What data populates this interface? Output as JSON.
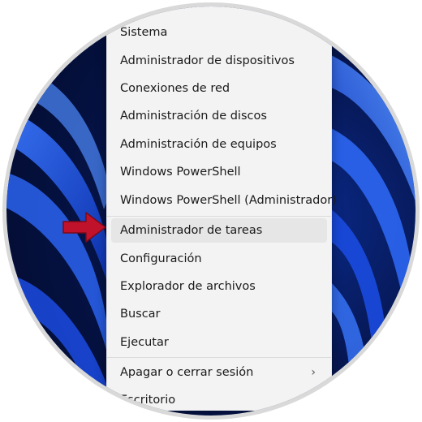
{
  "menu": {
    "items": [
      {
        "label": "Sistema"
      },
      {
        "label": "Administrador de dispositivos"
      },
      {
        "label": "Conexiones de red"
      },
      {
        "label": "Administración de discos"
      },
      {
        "label": "Administración de equipos"
      },
      {
        "label": "Windows PowerShell"
      },
      {
        "label": "Windows PowerShell (Administrador)"
      },
      {
        "label": "Administrador de tareas"
      },
      {
        "label": "Configuración"
      },
      {
        "label": "Explorador de archivos"
      },
      {
        "label": "Buscar"
      },
      {
        "label": "Ejecutar"
      },
      {
        "label": "Apagar o cerrar sesión",
        "submenu": "›"
      },
      {
        "label": "Escritorio"
      }
    ],
    "highlighted_item": "Administrador de tareas"
  },
  "colors": {
    "arrow": "#c0122b",
    "menu_background": "#f3f3f3",
    "highlight": "#e6e6e6",
    "wallpaper_blue": "#1a4fd8"
  },
  "icons": {
    "pointer": "red-arrow-icon",
    "submenu": "chevron-right-icon"
  }
}
